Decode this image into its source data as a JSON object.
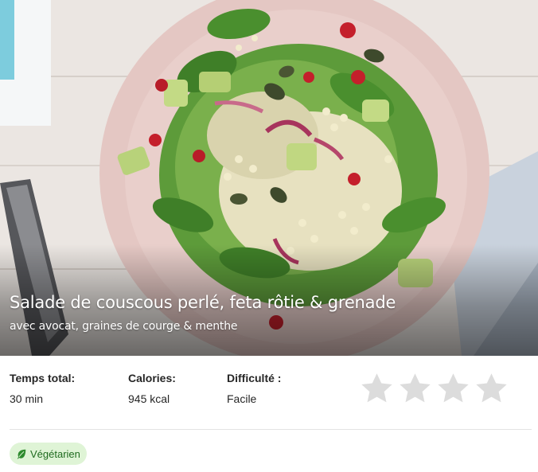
{
  "recipe": {
    "title": "Salade de couscous perlé, feta rôtie & grenade",
    "subtitle": "avec avocat, graines de courge & menthe"
  },
  "stats": {
    "time": {
      "label": "Temps total:",
      "value": "30 min"
    },
    "calories": {
      "label": "Calories:",
      "value": "945 kcal"
    },
    "difficulty": {
      "label": "Difficulté :",
      "value": "Facile"
    }
  },
  "rating": {
    "stars_total": 4,
    "stars_filled": 0,
    "star_color": "#dcdcdc"
  },
  "tags": [
    {
      "label": "Végétarien",
      "icon": "leaf-icon",
      "color": "#1f6b1f",
      "background": "#dff4d6"
    }
  ]
}
